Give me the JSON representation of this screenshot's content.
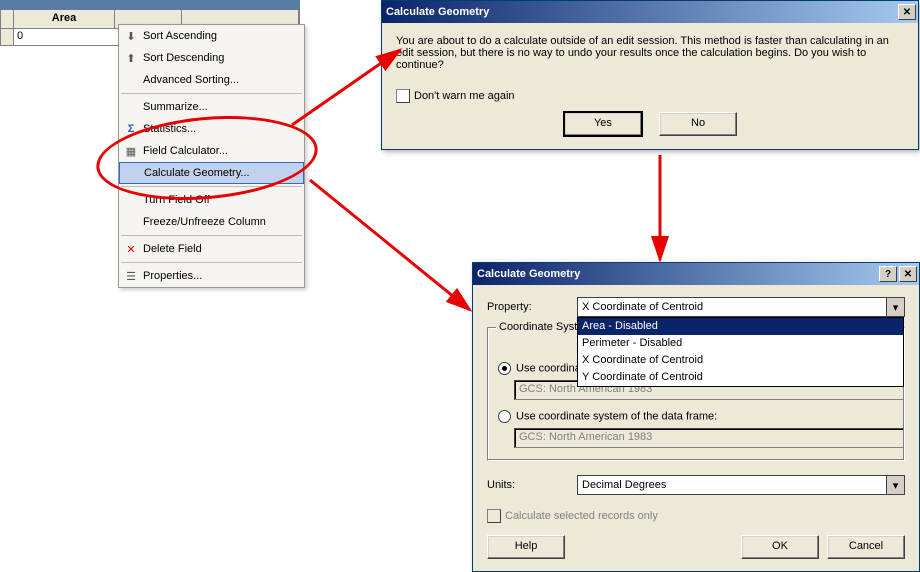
{
  "table": {
    "col": "Area",
    "val": "0"
  },
  "menu": {
    "sort_asc": "Sort Ascending",
    "sort_desc": "Sort Descending",
    "adv_sort": "Advanced Sorting...",
    "summarize": "Summarize...",
    "statistics": "Statistics...",
    "field_calc": "Field Calculator...",
    "calc_geom": "Calculate Geometry...",
    "turn_off": "Turn Field Off",
    "freeze": "Freeze/Unfreeze Column",
    "delete": "Delete Field",
    "props": "Properties..."
  },
  "warn": {
    "title": "Calculate Geometry",
    "msg": "You are about to do a calculate outside of an edit session. This method is faster than calculating in an edit session, but there is no way to undo your results once the calculation begins. Do you wish to continue?",
    "chk": "Don't warn me again",
    "yes": "Yes",
    "no": "No"
  },
  "dlg2": {
    "title": "Calculate Geometry",
    "property": "Property:",
    "prop_val": "X Coordinate of Centroid",
    "opts": {
      "a": "Area - Disabled",
      "p": "Perimeter - Disabled",
      "x": "X Coordinate of Centroid",
      "y": "Y Coordinate of Centroid"
    },
    "cs_legend": "Coordinate System",
    "cs_src": "Use coordinate system of the data source:",
    "cs_frame": "Use coordinate system of the data frame:",
    "gcs": "GCS: North American 1983",
    "units": "Units:",
    "units_val": "Decimal Degrees",
    "sel_only": "Calculate selected records only",
    "help": "Help",
    "ok": "OK",
    "cancel": "Cancel"
  }
}
